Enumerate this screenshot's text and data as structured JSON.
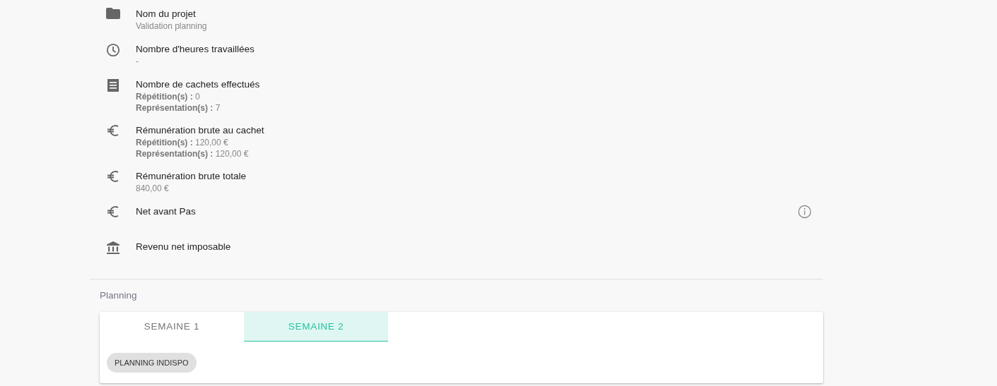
{
  "details": [
    {
      "kind": "folder",
      "label": "Nom du projet",
      "lines": [
        "Validation planning"
      ],
      "info": false
    },
    {
      "kind": "clock",
      "label": "Nombre d'heures travaillées",
      "lines": [
        "-"
      ],
      "info": false
    },
    {
      "kind": "ticket",
      "label": "Nombre de cachets effectués",
      "lines": [
        "**Répétition(s) :** 0",
        "**Représentation(s) :** 7"
      ],
      "info": false
    },
    {
      "kind": "euro",
      "label": "Rémunération brute au cachet",
      "lines": [
        "**Répétition(s) :** 120,00 €",
        "**Représentation(s) :** 120,00 €"
      ],
      "info": false
    },
    {
      "kind": "euro",
      "label": "Rémunération brute totale",
      "lines": [
        "840,00 €"
      ],
      "info": false
    },
    {
      "kind": "euro",
      "label": " Net avant Pas",
      "info": true
    },
    {
      "kind": "bank",
      "label": "Revenu net imposable",
      "info": false
    }
  ],
  "planning": {
    "title": "Planning",
    "tabs": [
      {
        "label": "SEMAINE 1",
        "selected": false
      },
      {
        "label": "SEMAINE 2",
        "selected": true
      }
    ],
    "chips": [
      "PLANNING INDISPO"
    ]
  }
}
